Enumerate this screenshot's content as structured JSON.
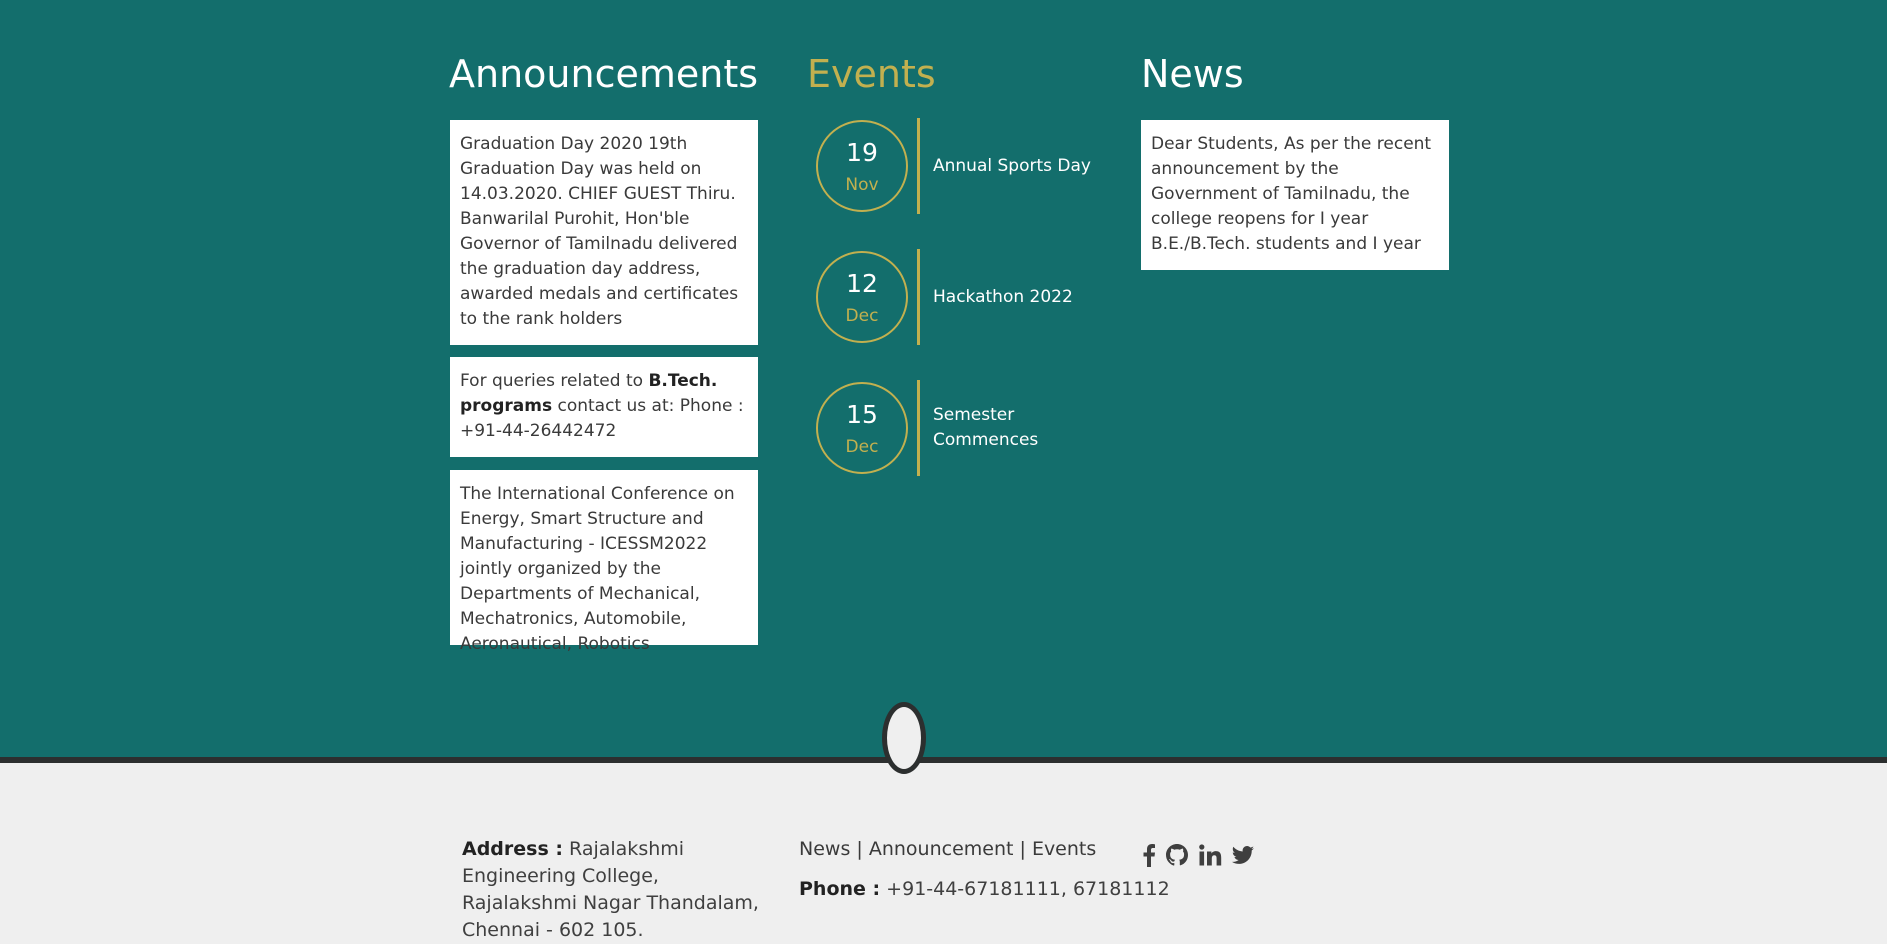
{
  "colors": {
    "teal": "#136e6c",
    "gold": "#c2b04f",
    "footer_bg": "#efefef",
    "dark": "#2c2f2f"
  },
  "announcements": {
    "title": "Announcements",
    "items": [
      {
        "text": "Graduation Day 2020 19th Graduation Day was held on 14.03.2020. CHIEF GUEST Thiru. Banwarilal Purohit, Hon'ble Governor of Tamilnadu delivered the graduation day address, awarded medals and certificates to the rank holders"
      },
      {
        "prefix": "For queries related to ",
        "bold": "B.Tech. programs",
        "suffix": " contact us at: Phone : +91-44-26442472"
      },
      {
        "text": "The International Conference on Energy, Smart Structure and Manufacturing - ICESSM2022 jointly organized by the Departments of Mechanical, Mechatronics, Automobile, Aeronautical, Robotics"
      }
    ]
  },
  "events": {
    "title": "Events",
    "items": [
      {
        "day": "19",
        "month": "Nov",
        "title": "Annual Sports Day"
      },
      {
        "day": "12",
        "month": "Dec",
        "title": "Hackathon 2022"
      },
      {
        "day": "15",
        "month": "Dec",
        "title": "Semester Commences"
      }
    ]
  },
  "news": {
    "title": "News",
    "items": [
      {
        "text": "Dear Students, As per the recent announcement by the Government of Tamilnadu, the college reopens for I year B.E./B.Tech. students and I year"
      }
    ]
  },
  "footer": {
    "address_label": "Address :",
    "address_text": " Rajalakshmi Engineering College, Rajalakshmi Nagar Thandalam, Chennai - 602 105.",
    "links": [
      "News",
      "Announcement",
      "Events"
    ],
    "separator": " | ",
    "phone_label": "Phone :",
    "phone_text": " +91-44-67181111, 67181112",
    "social_icons": [
      "facebook-icon",
      "github-icon",
      "linkedin-icon",
      "twitter-icon"
    ]
  }
}
